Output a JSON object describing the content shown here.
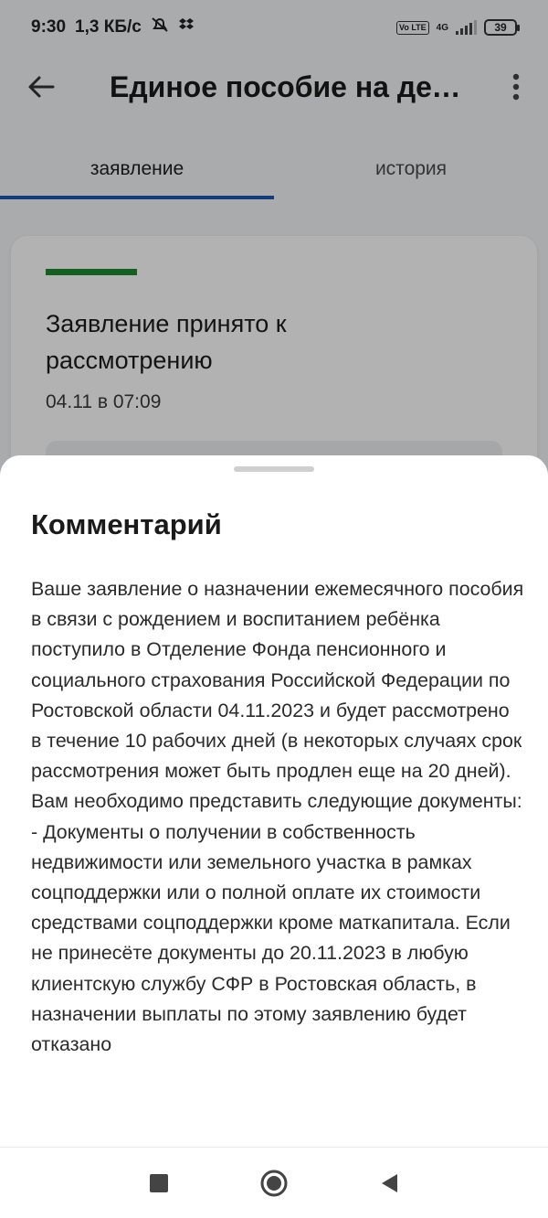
{
  "status_bar": {
    "time": "9:30",
    "speed": "1,3 КБ/с",
    "network": "4G",
    "volte": "Vo LTE",
    "battery": "39"
  },
  "app_bar": {
    "title": "Единое пособие на дет…",
    "back_icon": "arrow-back-icon",
    "more_icon": "more-vert-icon"
  },
  "tabs": [
    {
      "label": "заявление",
      "active": true
    },
    {
      "label": "история",
      "active": false
    }
  ],
  "card": {
    "title": "Заявление принято к рассмотрению",
    "date": "04.11 в 07:09",
    "accent_color": "#1e8a2e"
  },
  "sheet": {
    "title": "Комментарий",
    "body": "Ваше заявление о назначении ежемесячного пособия в связи с рождением и воспитанием ребёнка поступило в Отделение Фонда пенсионного и социального страхования Российской Федерации по Ростовской области 04.11.2023 и будет рассмотрено в течение 10 рабочих дней (в некоторых случаях срок рассмотрения может быть продлен еще на 20 дней). Вам необходимо представить следующие документы: - Документы о получении в собственность недвижимости или земельного участка в рамках соцподдержки или о полной оплате их стоимости средствами соцподдержки кроме маткапитала. Если не принесёте документы до 20.11.2023 в любую клиентскую службу СФР в Ростовская область, в назначении выплаты по этому заявлению будет отказано"
  },
  "nav_bar": {
    "items": [
      "recents-icon",
      "home-icon",
      "back-icon"
    ]
  },
  "colors": {
    "tab_indicator": "#1a56b0",
    "accent_green": "#1e8a2e"
  }
}
